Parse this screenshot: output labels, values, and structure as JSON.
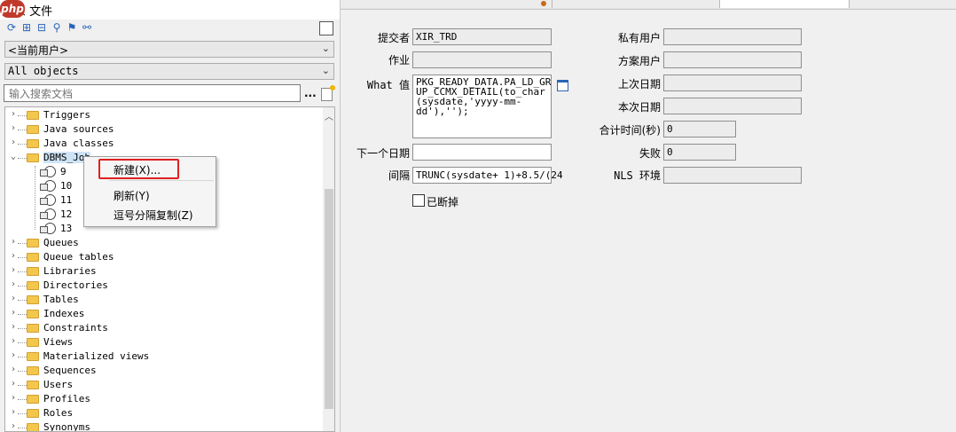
{
  "left_panel": {
    "title": "象 文件",
    "owner_filter": "<当前用户>",
    "object_filter": "All objects",
    "search_placeholder": "输入搜索文档",
    "search_button": "...",
    "tree": {
      "items_before": [
        "Triggers",
        "Java sources",
        "Java classes"
      ],
      "dbms_job": "DBMS_Job",
      "jobs": [
        "9",
        "10",
        "11",
        "12",
        "13"
      ],
      "items_after": [
        "Queues",
        "Queue tables",
        "Libraries",
        "Directories",
        "Tables",
        "Indexes",
        "Constraints",
        "Views",
        "Materialized views",
        "Sequences",
        "Users",
        "Profiles",
        "Roles",
        "Synonyms"
      ]
    }
  },
  "context_menu": {
    "items": [
      "新建(X)...",
      "刷新(Y)",
      "逗号分隔复制(Z)"
    ],
    "highlight_color": "#e02020"
  },
  "job_form": {
    "submitter_label": "提交者",
    "submitter_value": "XIR_TRD",
    "job_label": "作业",
    "job_value": "",
    "what_label": "What 值",
    "what_value": "PKG_READY_DATA.PA_LD_GRO\nUP_CCMX_DETAIL(to_char\n(sysdate,'yyyy-mm-\ndd'),'');",
    "next_date_label": "下一个日期",
    "next_date_value": "",
    "interval_label": "间隔",
    "interval_value": "TRUNC(sysdate+ 1)+8.5/(24",
    "broken_label": "已断掉",
    "priv_user_label": "私有用户",
    "priv_user_value": "",
    "schema_user_label": "方案用户",
    "schema_user_value": "",
    "last_date_label": "上次日期",
    "last_date_value": "",
    "this_date_label": "本次日期",
    "this_date_value": "",
    "total_time_label": "合计时间(秒)",
    "total_time_value": "0",
    "failures_label": "失败",
    "failures_value": "0",
    "nls_label": "NLS 环境",
    "nls_value": ""
  },
  "icons": [
    "refresh-icon",
    "add-icon",
    "remove-icon",
    "find-icon",
    "filter-icon",
    "link-icon",
    "folder-icon",
    "job-clock-icon",
    "new-document-icon",
    "edit-icon"
  ],
  "colors": {
    "highlight_box": "#e02020",
    "folder": "#f3c64c",
    "accent": "#2a64b8"
  }
}
